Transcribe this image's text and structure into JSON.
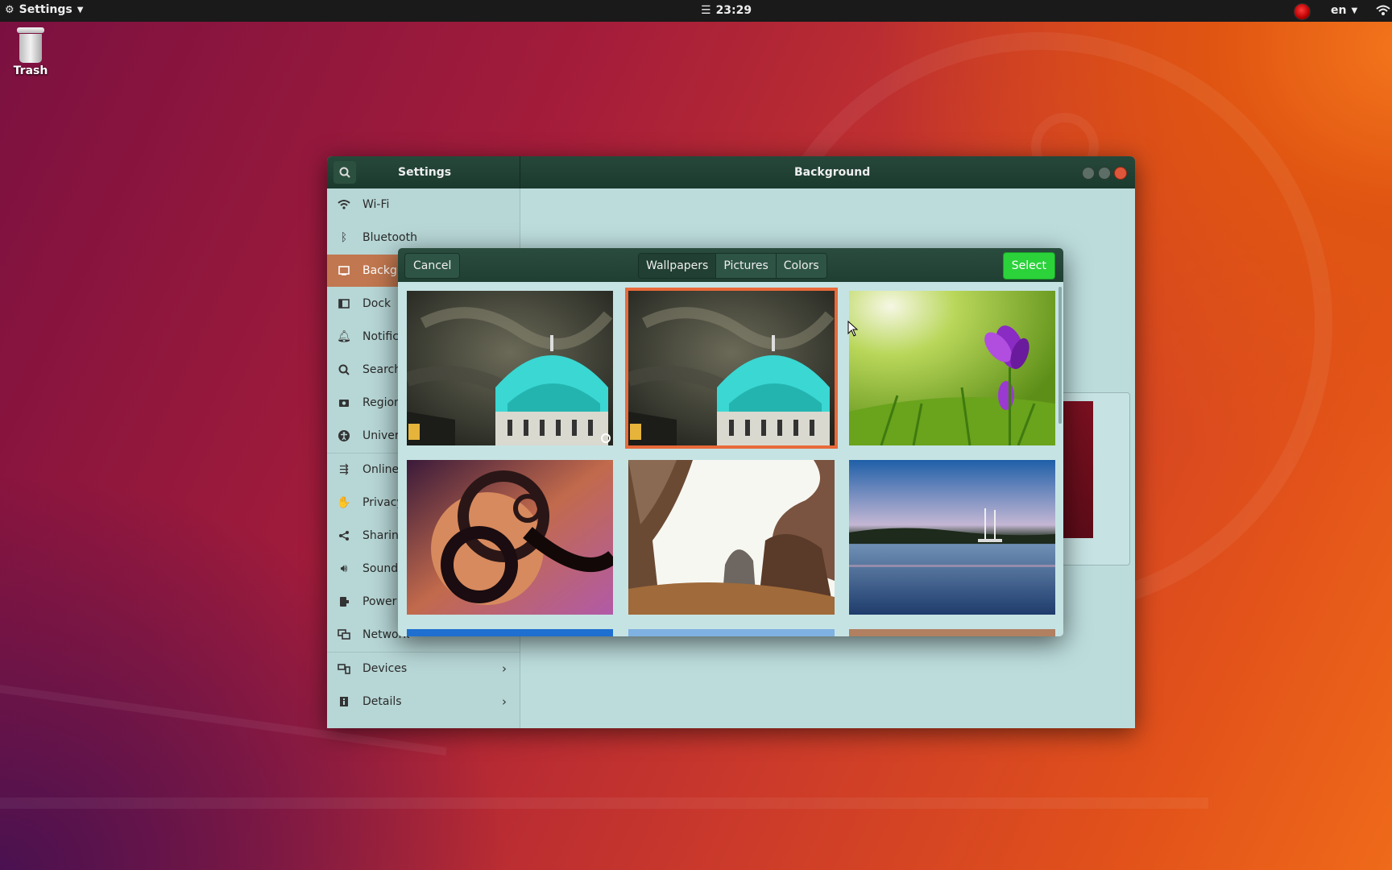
{
  "topbar": {
    "app_menu": "Settings",
    "clock": "23:29",
    "lang": "en"
  },
  "desktop": {
    "trash_label": "Trash"
  },
  "window": {
    "left_title": "Settings",
    "main_title": "Background"
  },
  "sidebar": {
    "items": [
      {
        "label": "Wi-Fi",
        "icon": "wifi-icon"
      },
      {
        "label": "Bluetooth",
        "icon": "bluetooth-icon"
      },
      {
        "label": "Backgr",
        "icon": "background-icon",
        "active": true
      },
      {
        "label": "Dock",
        "icon": "dock-icon"
      },
      {
        "label": "Notific",
        "icon": "bell-icon"
      },
      {
        "label": "Search",
        "icon": "search-icon"
      },
      {
        "label": "Region",
        "icon": "region-icon"
      },
      {
        "label": "Univers",
        "icon": "universal-access-icon"
      },
      {
        "label": "Online",
        "icon": "online-accounts-icon"
      },
      {
        "label": "Privacy",
        "icon": "privacy-hand-icon"
      },
      {
        "label": "Sharing",
        "icon": "share-icon"
      },
      {
        "label": "Sound",
        "icon": "speaker-icon"
      },
      {
        "label": "Power",
        "icon": "power-icon"
      },
      {
        "label": "Network",
        "icon": "network-icon"
      },
      {
        "label": "Devices",
        "icon": "devices-icon"
      },
      {
        "label": "Details",
        "icon": "info-icon"
      }
    ]
  },
  "dialog": {
    "cancel_label": "Cancel",
    "tabs": [
      "Wallpapers",
      "Pictures",
      "Colors"
    ],
    "active_tab": "Wallpapers",
    "select_label": "Select",
    "thumbnails": [
      {
        "name": "cathedral-dome",
        "selected": false
      },
      {
        "name": "cathedral-dome",
        "selected": true
      },
      {
        "name": "purple-crocus",
        "selected": false
      },
      {
        "name": "abstract-spiral",
        "selected": false
      },
      {
        "name": "rock-canyon",
        "selected": false
      },
      {
        "name": "lake-harbor",
        "selected": false
      }
    ]
  },
  "colors": {
    "titlebar": "#1f3f32",
    "sidebar_bg": "#b7d6d6",
    "active_item": "#c1774f",
    "select_button": "#2bd23a",
    "selection_outline": "#e86a3a"
  }
}
